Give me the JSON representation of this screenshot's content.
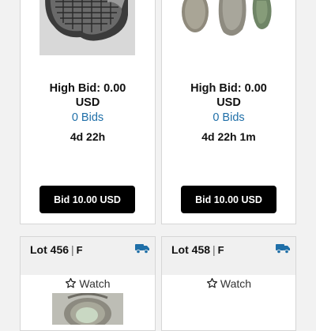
{
  "cards": [
    {
      "high_bid": "High Bid: 0.00",
      "currency": "USD",
      "bids": "0 Bids",
      "time_left": "4d 22h",
      "button": "Bid 10.00 USD"
    },
    {
      "high_bid": "High Bid: 0.00",
      "currency": "USD",
      "bids": "0 Bids",
      "time_left": "4d 22h 1m",
      "button": "Bid 10.00 USD"
    }
  ],
  "lots": [
    {
      "lot": "Lot 456",
      "separator": "|",
      "code": "F",
      "watch": "Watch",
      "shipping_icon": "truck-icon"
    },
    {
      "lot": "Lot 458",
      "separator": "|",
      "code": "F",
      "watch": "Watch",
      "shipping_icon": "truck-icon"
    }
  ],
  "colors": {
    "link": "#1f6fa8",
    "button_bg": "#000000",
    "truck": "#1f6fa8"
  }
}
